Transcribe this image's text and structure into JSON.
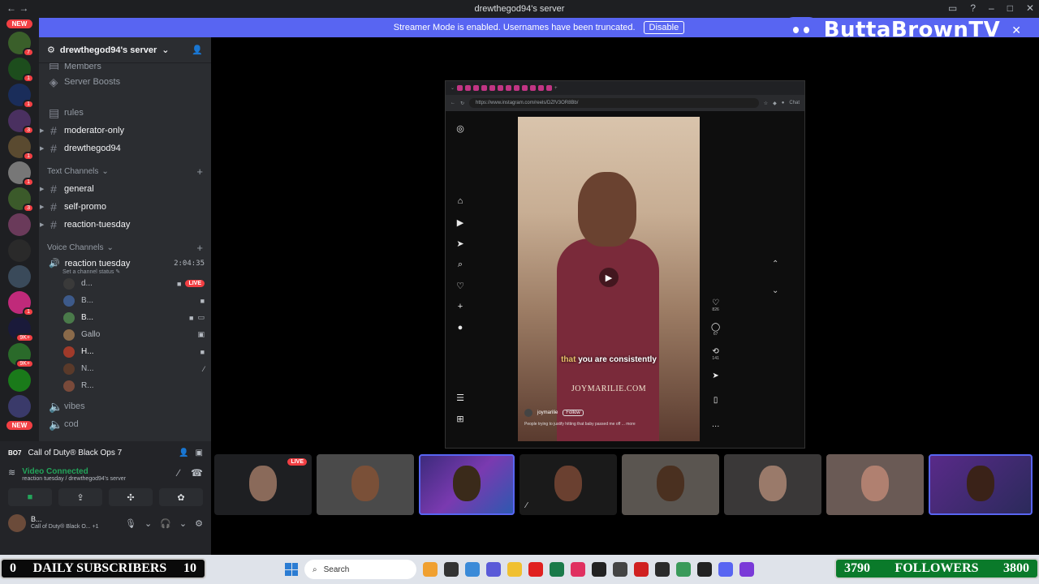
{
  "window": {
    "title": "drewthegod94's server"
  },
  "banner": {
    "text": "Streamer Mode is enabled. Usernames have been truncated.",
    "button": "Disable",
    "color": "#5865f2"
  },
  "brand": {
    "name": "ButtaBrownTV"
  },
  "guild_rail": {
    "new_label": "NEW",
    "badges": [
      "7",
      "1",
      "1",
      "3",
      "1",
      "1",
      "3",
      "9K+",
      "9K+",
      "1"
    ]
  },
  "sidebar": {
    "server_name": "drewthegod94's server",
    "items_top": [
      {
        "icon": "members-icon",
        "label": "Members"
      },
      {
        "icon": "boost-icon",
        "label": "Server Boosts"
      },
      {
        "icon": "rules-icon",
        "label": "rules"
      },
      {
        "icon": "hash-icon",
        "label": "moderator-only"
      },
      {
        "icon": "hash-icon",
        "label": "drewthegod94"
      }
    ],
    "text_category": "Text Channels",
    "text_channels": [
      "general",
      "self-promo",
      "reaction-tuesday"
    ],
    "voice_category": "Voice Channels",
    "voice_channel": {
      "name": "reaction tuesday",
      "timer": "2:04:35",
      "status": "Set a channel status"
    },
    "voice_users": [
      {
        "name": "d...",
        "live": "LIVE"
      },
      {
        "name": "B..."
      },
      {
        "name": "B..."
      },
      {
        "name": "Gallo"
      },
      {
        "name": "H..."
      },
      {
        "name": "N..."
      },
      {
        "name": "R..."
      }
    ],
    "more_channels": [
      "vibes",
      "cod"
    ]
  },
  "panel": {
    "game": "Call of Duty® Black Ops 7",
    "connection": "Video Connected",
    "connection_sub": "reaction tuesday / drewthegod94's server",
    "user_name": "B...",
    "user_status": "Call of Duty® Black O...",
    "user_extra": "+1"
  },
  "shared_screen": {
    "url": "https://www.instagram.com/reels/DZfV3OR8Bb/",
    "chat_label": "Chat",
    "caption_highlight": "that",
    "caption_rest": " you are consistently",
    "watermark": "JOYMARILIE.COM",
    "account": "joymarilie",
    "follow": "Follow",
    "description": "People trying to justify hitting that baby passed me off ... more",
    "counts": {
      "likes": "826",
      "comments": "67",
      "reposts": "141"
    }
  },
  "tiles": {
    "live_label": "LIVE",
    "count": 8
  },
  "taskbar": {
    "search": "Search"
  },
  "overlays": {
    "subs_left": "0",
    "subs_label": "DAILY SUBSCRIBERS",
    "subs_right": "10",
    "followers_left": "3790",
    "followers_label": "FOLLOWERS",
    "followers_right": "3800"
  }
}
